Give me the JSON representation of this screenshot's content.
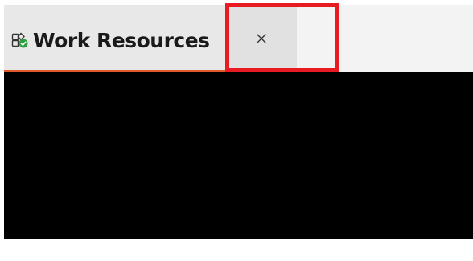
{
  "tab": {
    "title": "Work Resources",
    "icon": "workspace-check-icon",
    "close_icon": "close-icon"
  },
  "colors": {
    "active_tab_indicator": "#e05a2b",
    "status_check": "#2e9e3e",
    "highlight_box": "#e81b23",
    "content_background": "#000000"
  }
}
